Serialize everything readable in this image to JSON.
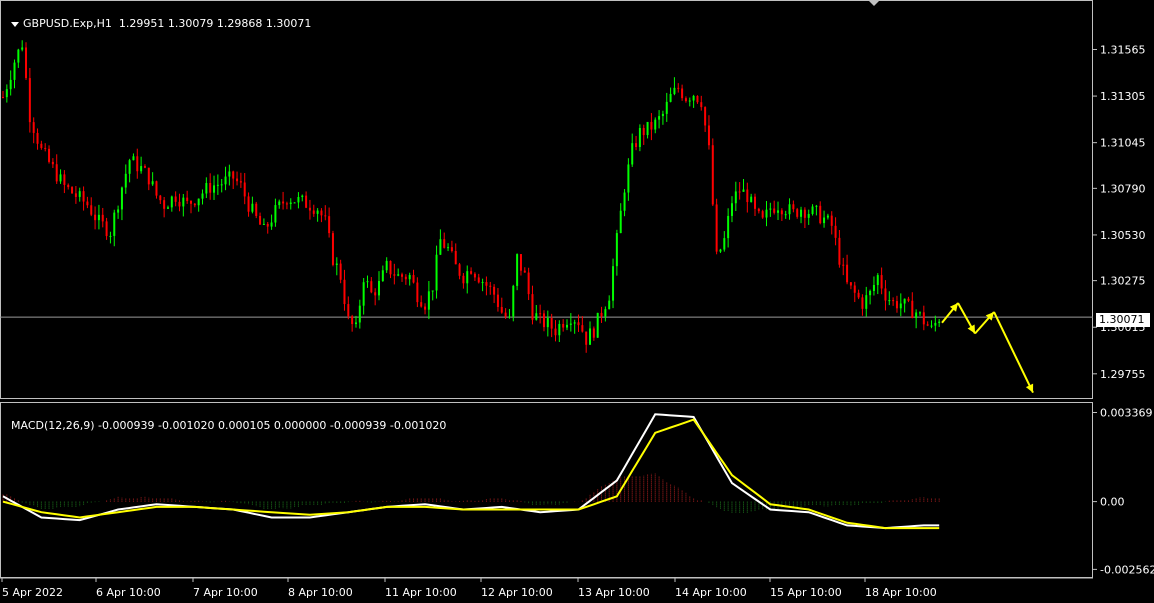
{
  "header": {
    "symbol": "GBPUSD.Exp,H1",
    "ohlc": "1.29951 1.30079 1.29868 1.30071"
  },
  "current_price": "1.30071",
  "macd_header": {
    "name": "MACD(12,26,9)",
    "values": "-0.000939 -0.001020 0.000105 0.000000 -0.000939 -0.001020"
  },
  "chart_data": [
    {
      "type": "candlestick",
      "title": "GBPUSD.Exp,H1",
      "y_ticks": [
        "1.31565",
        "1.31305",
        "1.31045",
        "1.30790",
        "1.30530",
        "1.30275",
        "1.30015",
        "1.29755"
      ],
      "ylim": [
        1.2962,
        1.3183
      ],
      "x_tick_labels": [
        "5 Apr 2022",
        "6 Apr 10:00",
        "7 Apr 10:00",
        "8 Apr 10:00",
        "11 Apr 10:00",
        "12 Apr 10:00",
        "13 Apr 10:00",
        "14 Apr 10:00",
        "15 Apr 10:00",
        "18 Apr 10:00"
      ],
      "colors": {
        "up": "#00ff00",
        "down": "#ff0000",
        "forecast_arrows": "#ffff00"
      },
      "close_path": [
        [
          0,
          1.313
        ],
        [
          3,
          1.315
        ],
        [
          5,
          1.316
        ],
        [
          7,
          1.312
        ],
        [
          10,
          1.31
        ],
        [
          13,
          1.309
        ],
        [
          16,
          1.308
        ],
        [
          19,
          1.3075
        ],
        [
          22,
          1.307
        ],
        [
          25,
          1.306
        ],
        [
          28,
          1.3055
        ],
        [
          31,
          1.308
        ],
        [
          33,
          1.3095
        ],
        [
          36,
          1.309
        ],
        [
          38,
          1.3085
        ],
        [
          40,
          1.3075
        ],
        [
          42,
          1.307
        ],
        [
          45,
          1.3075
        ],
        [
          48,
          1.307
        ],
        [
          51,
          1.3075
        ],
        [
          54,
          1.308
        ],
        [
          57,
          1.3082
        ],
        [
          60,
          1.3085
        ],
        [
          62,
          1.308
        ],
        [
          64,
          1.307
        ],
        [
          66,
          1.3062
        ],
        [
          68,
          1.3055
        ],
        [
          71,
          1.3066
        ],
        [
          74,
          1.3074
        ],
        [
          77,
          1.3072
        ],
        [
          80,
          1.307
        ],
        [
          82,
          1.3068
        ],
        [
          84,
          1.306
        ],
        [
          86,
          1.304
        ],
        [
          88,
          1.303
        ],
        [
          90,
          1.3005
        ],
        [
          92,
          1.3
        ],
        [
          94,
          1.303
        ],
        [
          96,
          1.302
        ],
        [
          98,
          1.3025
        ],
        [
          100,
          1.3035
        ],
        [
          103,
          1.303
        ],
        [
          106,
          1.303
        ],
        [
          108,
          1.302
        ],
        [
          110,
          1.3015
        ],
        [
          112,
          1.3025
        ],
        [
          114,
          1.305
        ],
        [
          116,
          1.3045
        ],
        [
          118,
          1.3035
        ],
        [
          120,
          1.303
        ],
        [
          122,
          1.3035
        ],
        [
          124,
          1.303
        ],
        [
          126,
          1.3025
        ],
        [
          128,
          1.302
        ],
        [
          130,
          1.301
        ],
        [
          132,
          1.3005
        ],
        [
          134,
          1.304
        ],
        [
          136,
          1.303
        ],
        [
          138,
          1.301
        ],
        [
          140,
          1.3005
        ],
        [
          142,
          1.3003
        ],
        [
          144,
          1.3
        ],
        [
          146,
          1.3005
        ],
        [
          148,
          1.3008
        ],
        [
          150,
          1.3005
        ],
        [
          152,
          1.2995
        ],
        [
          154,
          1.3
        ],
        [
          156,
          1.301
        ],
        [
          158,
          1.302
        ],
        [
          160,
          1.305
        ],
        [
          162,
          1.308
        ],
        [
          164,
          1.31
        ],
        [
          166,
          1.311
        ],
        [
          168,
          1.3112
        ],
        [
          170,
          1.3115
        ],
        [
          172,
          1.312
        ],
        [
          174,
          1.313
        ],
        [
          176,
          1.3135
        ],
        [
          178,
          1.313
        ],
        [
          180,
          1.3132
        ],
        [
          182,
          1.3128
        ],
        [
          184,
          1.31
        ],
        [
          186,
          1.304
        ],
        [
          188,
          1.305
        ],
        [
          190,
          1.3072
        ],
        [
          192,
          1.3078
        ],
        [
          194,
          1.3075
        ],
        [
          196,
          1.3065
        ],
        [
          198,
          1.306
        ],
        [
          200,
          1.3068
        ],
        [
          202,
          1.307
        ],
        [
          204,
          1.3068
        ],
        [
          206,
          1.3065
        ],
        [
          208,
          1.3068
        ],
        [
          210,
          1.3066
        ],
        [
          212,
          1.3065
        ],
        [
          214,
          1.3062
        ],
        [
          216,
          1.3058
        ],
        [
          218,
          1.304
        ],
        [
          220,
          1.3025
        ],
        [
          222,
          1.302
        ],
        [
          224,
          1.3015
        ],
        [
          226,
          1.302
        ],
        [
          228,
          1.303
        ],
        [
          230,
          1.302
        ],
        [
          232,
          1.3015
        ],
        [
          234,
          1.3015
        ],
        [
          236,
          1.3012
        ],
        [
          238,
          1.301
        ],
        [
          240,
          1.3005
        ],
        [
          242,
          1.3
        ],
        [
          244,
          1.3007
        ]
      ],
      "forecast_arrows": [
        [
          1.3004,
          1.3015
        ],
        [
          1.3015,
          1.2998
        ],
        [
          1.2998,
          1.301
        ],
        [
          1.301,
          1.2965
        ]
      ]
    },
    {
      "type": "line",
      "title": "MACD(12,26,9)",
      "y_ticks": [
        "0.003369",
        "0.00",
        "-0.002562"
      ],
      "ylim": [
        -0.00285,
        0.00369
      ],
      "x": [
        0,
        10,
        20,
        30,
        40,
        50,
        60,
        70,
        80,
        90,
        100,
        110,
        120,
        130,
        140,
        150,
        160,
        170,
        180,
        190,
        200,
        210,
        220,
        230,
        240,
        245
      ],
      "series": [
        {
          "color": "#ffffff",
          "values": [
            0.0002,
            -0.0006,
            -0.0007,
            -0.0003,
            -0.0001,
            -0.0002,
            -0.0003,
            -0.0006,
            -0.0006,
            -0.0004,
            -0.0002,
            -0.0001,
            -0.0003,
            -0.0002,
            -0.0004,
            -0.0003,
            0.0008,
            0.0033,
            0.0032,
            0.0007,
            -0.0003,
            -0.0004,
            -0.0009,
            -0.001,
            -0.0009,
            -0.0009
          ]
        },
        {
          "color": "#ffff00",
          "values": [
            0.0,
            -0.0004,
            -0.0006,
            -0.0004,
            -0.0002,
            -0.0002,
            -0.0003,
            -0.0004,
            -0.0005,
            -0.0004,
            -0.0002,
            -0.0002,
            -0.0003,
            -0.0003,
            -0.0003,
            -0.0003,
            0.0002,
            0.0026,
            0.0031,
            0.001,
            -0.0001,
            -0.0003,
            -0.0008,
            -0.001,
            -0.001,
            -0.001
          ]
        }
      ]
    }
  ]
}
